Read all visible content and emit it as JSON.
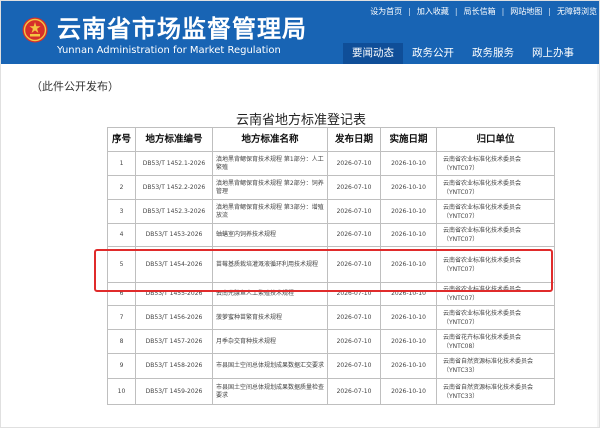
{
  "header": {
    "site_name": "云南省市场监督管理局",
    "site_name_en": "Yunnan Administration for Market Regulation",
    "top_links": [
      "设为首页",
      "加入收藏",
      "局长信箱",
      "网站地图",
      "无障碍浏览"
    ],
    "nav": [
      "要闻动态",
      "政务公开",
      "政务服务",
      "网上办事"
    ],
    "colors": {
      "header_bg": "#1864b4",
      "nav_active": "#0f4e98",
      "highlight": "#e02b2b"
    }
  },
  "notice": "（此件公开发布）",
  "doc_title": "云南省地方标准登记表",
  "table": {
    "headers": [
      "序号",
      "地方标准编号",
      "地方标准名称",
      "发布日期",
      "实施日期",
      "归口单位"
    ],
    "rows": [
      {
        "no": "1",
        "code": "DB53/T 1452.1-2026",
        "name": "滇地黑背鳃保育技术规程 第1部分：人工繁殖",
        "pub": "2026-07-10",
        "impl": "2026-10-10",
        "unit": "云南省农业标准化技术委员会（YNTC07）"
      },
      {
        "no": "2",
        "code": "DB53/T 1452.2-2026",
        "name": "滇地黑背鳃保育技术规程 第2部分：饲养管理",
        "pub": "2026-07-10",
        "impl": "2026-10-10",
        "unit": "云南省农业标准化技术委员会（YNTC07）"
      },
      {
        "no": "3",
        "code": "DB53/T 1452.3-2026",
        "name": "滇地黑背鳃保育技术规程 第3部分：增殖放流",
        "pub": "2026-07-10",
        "impl": "2026-10-10",
        "unit": "云南省农业标准化技术委员会（YNTC07）"
      },
      {
        "no": "4",
        "code": "DB53/T 1453-2026",
        "name": "蚰蟮室内饲养技术规程",
        "pub": "2026-07-10",
        "impl": "2026-10-10",
        "unit": "云南省农业标准化技术委员会（YNTC07）"
      },
      {
        "no": "5",
        "code": "DB53/T 1454-2026",
        "name": "苗莓基质栽培灌溉液循环利用技术规程",
        "pub": "2026-07-10",
        "impl": "2026-10-10",
        "unit": "云南省农业标准化技术委员会（YNTC07）"
      },
      {
        "no": "6",
        "code": "DB53/T 1455-2026",
        "name": "云南光腺鱼人工繁殖技术规程",
        "pub": "2026-07-10",
        "impl": "2026-10-10",
        "unit": "云南省农业标准化技术委员会（YNTC07）"
      },
      {
        "no": "7",
        "code": "DB53/T 1456-2026",
        "name": "菠萝蜜种苗繁育技术规程",
        "pub": "2026-07-10",
        "impl": "2026-10-10",
        "unit": "云南省农业标准化技术委员会（YNTC07）"
      },
      {
        "no": "8",
        "code": "DB53/T 1457-2026",
        "name": "月季杂交育种技术规程",
        "pub": "2026-07-10",
        "impl": "2026-10-10",
        "unit": "云南省花卉标准化技术委员会（YNTC08）"
      },
      {
        "no": "9",
        "code": "DB53/T 1458-2026",
        "name": "市县国土空间总体规划成果数据汇交要求",
        "pub": "2026-07-10",
        "impl": "2026-10-10",
        "unit": "云南省自然资源标准化技术委员会（YNTC33）"
      },
      {
        "no": "10",
        "code": "DB53/T 1459-2026",
        "name": "市县国土空间总体规划成果数据质量检查要求",
        "pub": "2026-07-10",
        "impl": "2026-10-10",
        "unit": "云南省自然资源标准化技术委员会（YNTC33）"
      }
    ]
  }
}
